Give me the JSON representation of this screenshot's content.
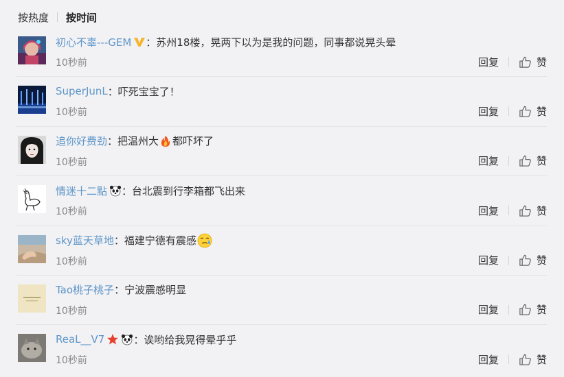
{
  "sort_tabs": {
    "hot": "按热度",
    "time": "按时间"
  },
  "actions": {
    "reply": "回复",
    "like": "赞"
  },
  "colors": {
    "username": "#5d95c7",
    "text": "#333333",
    "time": "#888888",
    "background": "#f2f2f5"
  },
  "comments": [
    {
      "username": "初心不辜---GEM",
      "badges": [
        "vip-v-icon"
      ],
      "colon": "：",
      "text_before": "苏州18楼，晃两下以为是我的问题，同事都说晃头晕",
      "emoji": "",
      "text_after": "",
      "time": "10秒前"
    },
    {
      "username": "SuperJunL",
      "badges": [],
      "colon": "：",
      "text_before": "吓死宝宝了！",
      "emoji": "",
      "text_after": "",
      "time": "10秒前"
    },
    {
      "username": "追你好费劲",
      "badges": [],
      "colon": "：",
      "text_before": "把温州大",
      "emoji": "fire-emoji",
      "text_after": "都吓坏了",
      "time": "10秒前"
    },
    {
      "username": "情迷十二點",
      "badges": [
        "panda-icon"
      ],
      "colon": "：",
      "text_before": "台北震到行李箱都飞出来",
      "emoji": "",
      "text_after": "",
      "time": "10秒前"
    },
    {
      "username": "sky蓝天草地",
      "badges": [],
      "colon": "：",
      "text_before": "福建宁德有震感",
      "emoji": "sweat-face-emoji",
      "text_after": "",
      "time": "10秒前"
    },
    {
      "username": "Tao桃子桃子",
      "badges": [],
      "colon": "：",
      "text_before": "宁波震感明显",
      "emoji": "",
      "text_after": "",
      "time": "10秒前"
    },
    {
      "username": "ReaL__V7",
      "badges": [
        "red-star-icon",
        "panda-icon"
      ],
      "colon": "：",
      "text_before": "诶哟给我晃得晕乎乎",
      "emoji": "",
      "text_after": "",
      "time": "10秒前"
    }
  ]
}
